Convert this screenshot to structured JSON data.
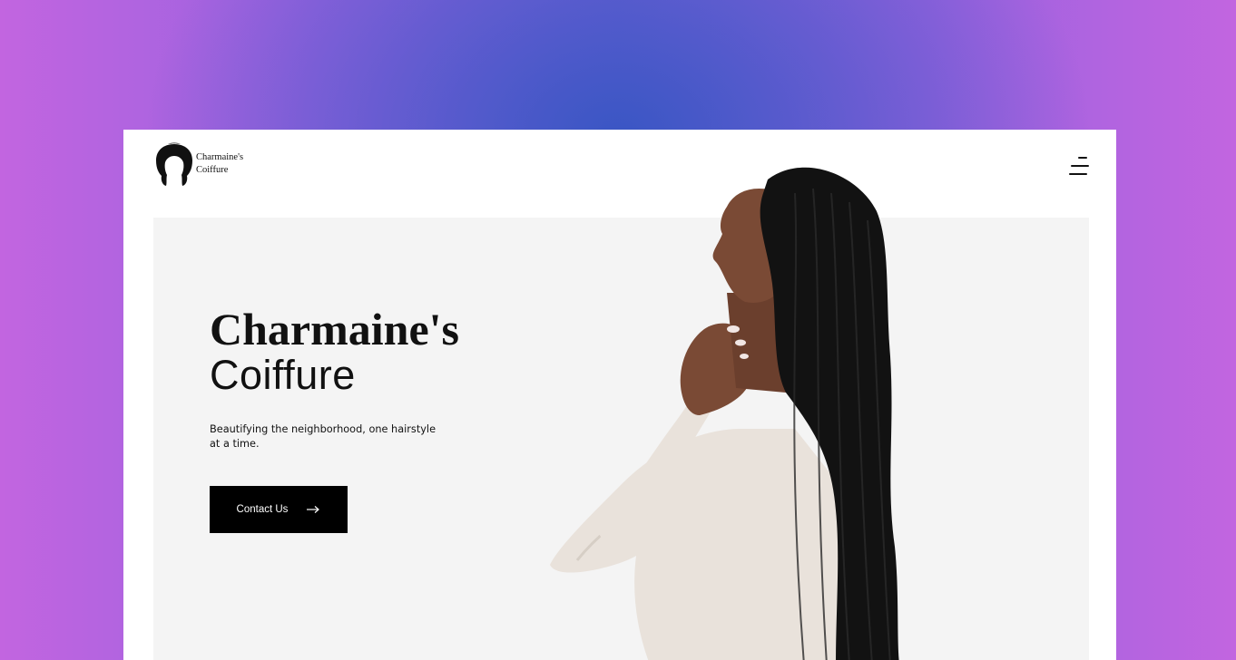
{
  "brand": {
    "line1": "Charmaine's",
    "line2": "Coiffure",
    "logo_icon": "afro-silhouette-icon"
  },
  "nav": {
    "menu_icon": "hamburger-menu-icon"
  },
  "hero": {
    "title_bold": "Charmaine's",
    "title_light": "Coiffure",
    "tagline": "Beautifying the neighborhood, one hairstyle at a time.",
    "cta_label": "Contact Us",
    "cta_icon": "arrow-right-icon",
    "photo_subject": "woman with long braids"
  },
  "colors": {
    "background_gradient": [
      "#c265e0",
      "#3a56c4"
    ],
    "hero_panel": "#f4f4f4",
    "cta_background": "#000000"
  }
}
